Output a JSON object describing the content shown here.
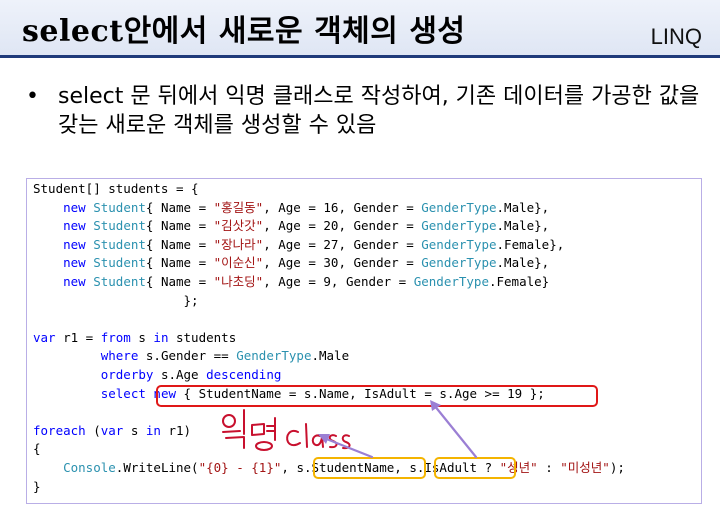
{
  "header": {
    "title": "select안에서 새로운 객체의 생성",
    "tag": "LINQ"
  },
  "bullet": {
    "symbol": "•",
    "text": "select 문 뒤에서 익명 클래스로 작성하여, 기존 데이터를 가공한 값을 갖는 새로운 객체를 생성할 수 있음"
  },
  "code": {
    "lines": [
      [
        [
          "p",
          "Student[] students = {"
        ]
      ],
      [
        [
          "p",
          "    "
        ],
        [
          "k",
          "new"
        ],
        [
          "p",
          " "
        ],
        [
          "t",
          "Student"
        ],
        [
          "p",
          "{ Name = "
        ],
        [
          "s",
          "\"홍길동\""
        ],
        [
          "p",
          ", Age = 16, Gender = "
        ],
        [
          "t",
          "GenderType"
        ],
        [
          "p",
          ".Male},"
        ]
      ],
      [
        [
          "p",
          "    "
        ],
        [
          "k",
          "new"
        ],
        [
          "p",
          " "
        ],
        [
          "t",
          "Student"
        ],
        [
          "p",
          "{ Name = "
        ],
        [
          "s",
          "\"김삿갓\""
        ],
        [
          "p",
          ", Age = 20, Gender = "
        ],
        [
          "t",
          "GenderType"
        ],
        [
          "p",
          ".Male},"
        ]
      ],
      [
        [
          "p",
          "    "
        ],
        [
          "k",
          "new"
        ],
        [
          "p",
          " "
        ],
        [
          "t",
          "Student"
        ],
        [
          "p",
          "{ Name = "
        ],
        [
          "s",
          "\"장나라\""
        ],
        [
          "p",
          ", Age = 27, Gender = "
        ],
        [
          "t",
          "GenderType"
        ],
        [
          "p",
          ".Female},"
        ]
      ],
      [
        [
          "p",
          "    "
        ],
        [
          "k",
          "new"
        ],
        [
          "p",
          " "
        ],
        [
          "t",
          "Student"
        ],
        [
          "p",
          "{ Name = "
        ],
        [
          "s",
          "\"이순신\""
        ],
        [
          "p",
          ", Age = 30, Gender = "
        ],
        [
          "t",
          "GenderType"
        ],
        [
          "p",
          ".Male},"
        ]
      ],
      [
        [
          "p",
          "    "
        ],
        [
          "k",
          "new"
        ],
        [
          "p",
          " "
        ],
        [
          "t",
          "Student"
        ],
        [
          "p",
          "{ Name = "
        ],
        [
          "s",
          "\"나초딩\""
        ],
        [
          "p",
          ", Age = 9, Gender = "
        ],
        [
          "t",
          "GenderType"
        ],
        [
          "p",
          ".Female}"
        ]
      ],
      [
        [
          "p",
          "                    };"
        ]
      ],
      [
        [
          "p",
          ""
        ]
      ],
      [
        [
          "k",
          "var"
        ],
        [
          "p",
          " r1 = "
        ],
        [
          "k",
          "from"
        ],
        [
          "p",
          " s "
        ],
        [
          "k",
          "in"
        ],
        [
          "p",
          " students"
        ]
      ],
      [
        [
          "p",
          "         "
        ],
        [
          "k",
          "where"
        ],
        [
          "p",
          " s.Gender == "
        ],
        [
          "t",
          "GenderType"
        ],
        [
          "p",
          ".Male"
        ]
      ],
      [
        [
          "p",
          "         "
        ],
        [
          "k",
          "orderby"
        ],
        [
          "p",
          " s.Age "
        ],
        [
          "k",
          "descending"
        ]
      ],
      [
        [
          "p",
          "         "
        ],
        [
          "k",
          "select"
        ],
        [
          "p",
          " "
        ],
        [
          "k",
          "new"
        ],
        [
          "p",
          " { StudentName = s.Name, IsAdult = s.Age >= 19 };"
        ]
      ],
      [
        [
          "p",
          ""
        ]
      ],
      [
        [
          "k",
          "foreach"
        ],
        [
          "p",
          " ("
        ],
        [
          "k",
          "var"
        ],
        [
          "p",
          " s "
        ],
        [
          "k",
          "in"
        ],
        [
          "p",
          " r1)"
        ]
      ],
      [
        [
          "p",
          "{"
        ]
      ],
      [
        [
          "p",
          "    "
        ],
        [
          "t",
          "Console"
        ],
        [
          "p",
          ".WriteLine("
        ],
        [
          "s",
          "\"{0} - {1}\""
        ],
        [
          "p",
          ", s.StudentName, s.IsAdult ? "
        ],
        [
          "s",
          "\"성년\""
        ],
        [
          "p",
          " : "
        ],
        [
          "s",
          "\"미성년\""
        ],
        [
          "p",
          ");"
        ]
      ],
      [
        [
          "p",
          "}"
        ]
      ]
    ]
  },
  "annotation": {
    "handwritten_note": "익명 class",
    "colors": {
      "red_box": "#e01818",
      "yellow_box": "#f4b400",
      "arrow": "#9b7fd4",
      "handwriting": "#c8102e"
    }
  },
  "colors": {
    "keyword": "#0000ff",
    "type": "#2b91af",
    "string": "#a31515",
    "title_bar": "#dfe6f4",
    "title_rule": "#1f3a7a"
  }
}
